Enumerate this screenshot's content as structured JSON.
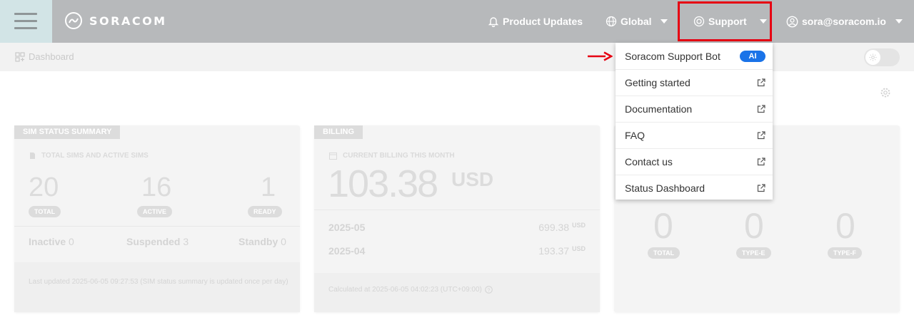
{
  "header": {
    "brand": "SORACOM",
    "product_updates": "Product Updates",
    "region": "Global",
    "support": "Support",
    "user": "sora@soracom.io"
  },
  "breadcrumb": {
    "label": "Dashboard"
  },
  "support_menu": {
    "items": [
      {
        "label": "Soracom Support Bot",
        "badge": "AI"
      },
      {
        "label": "Getting started",
        "icon": "external-link-icon"
      },
      {
        "label": "Documentation",
        "icon": "external-link-icon"
      },
      {
        "label": "FAQ",
        "icon": "external-link-icon"
      },
      {
        "label": "Contact us",
        "icon": "external-link-icon"
      },
      {
        "label": "Status Dashboard",
        "icon": "external-link-icon"
      }
    ]
  },
  "sim_card": {
    "tab": "SIM STATUS SUMMARY",
    "subtitle": "TOTAL SIMS AND ACTIVE SIMS",
    "stats": [
      {
        "value": "20",
        "label": "TOTAL"
      },
      {
        "value": "16",
        "label": "ACTIVE"
      },
      {
        "value": "1",
        "label": "READY"
      }
    ],
    "secondary": [
      {
        "label": "Inactive",
        "value": "0"
      },
      {
        "label": "Suspended",
        "value": "3"
      },
      {
        "label": "Standby",
        "value": "0"
      }
    ],
    "footer": "Last updated 2025-06-05 09:27:53 (SIM status summary is updated once per day)"
  },
  "billing_card": {
    "tab": "BILLING",
    "subtitle": "CURRENT BILLING THIS MONTH",
    "amount": "103.38",
    "currency": "USD",
    "rows": [
      {
        "month": "2025-05",
        "amount": "699.38",
        "unit": "USD"
      },
      {
        "month": "2025-04",
        "amount": "193.37",
        "unit": "USD"
      }
    ],
    "footer": "Calculated at 2025-06-05 04:02:23 (UTC+09:00)"
  },
  "third_card": {
    "stats": [
      {
        "value": "0",
        "label": "TOTAL"
      },
      {
        "value": "0",
        "label": "TYPE-E"
      },
      {
        "value": "0",
        "label": "TYPE-F"
      }
    ]
  },
  "colors": {
    "highlight": "#e60012",
    "ai_badge": "#1a73e8",
    "header": "#b7b9bb"
  }
}
